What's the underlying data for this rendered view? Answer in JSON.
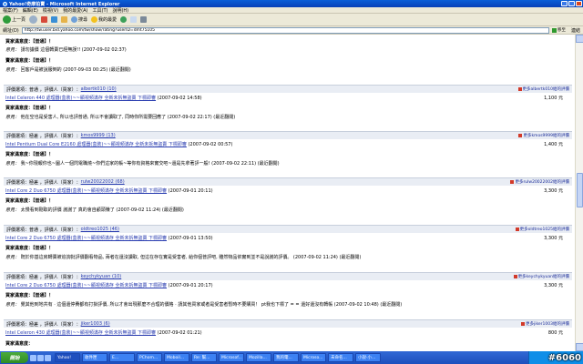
{
  "window": {
    "title": "Yahoo!奇摩拍賣 - Microsoft Internet Explorer",
    "menu": [
      "檔案(F)",
      "編輯(E)",
      "檢視(V)",
      "我的最愛(A)",
      "工具(T)",
      "說明(H)"
    ],
    "toolbar": {
      "back": "上一頁",
      "search": "搜尋",
      "favorites": "我的最愛"
    },
    "address_label": "網址(D)",
    "address_url": "http://tw.user.bid.yahoo.com/tw/show/rating?userID=dmt75105",
    "go_label": "移至",
    "links_label": "連結"
  },
  "top_comments": [
    {
      "label": "買家滿意度：",
      "value": "【普通】！"
    },
    {
      "label": "意見：",
      "text": "請勿議價 這個轉賣已經無誤!! (2007-09-02 02:37)"
    },
    {
      "label": "賣家滿意度：",
      "value": "【普通】！"
    },
    {
      "label": "意見：",
      "text": "回客戶是被說服倒的 (2007-09-03 00:25) (最近翻閱)"
    }
  ],
  "entries": [
    {
      "rating": "普通",
      "role": "評價人（買家）",
      "user": "albertk010 (10)",
      "more": "更多albertk010給的評價",
      "item": "Intel Celeron 440 處理器(盒裝)~~顯視頻滿存 全新未拆無盜賣 下標即審",
      "date": "(2007-09-02 14:58)",
      "price": "1,100 元",
      "buyer_sat": "【普通】！",
      "comment": "他在空也是受害人, 所以也評普通, 所以不會讀取了, 同時你所需要回應了 (2007-09-02 22:17) (最近翻閱)"
    },
    {
      "rating": "極差",
      "role": "評價人（買家）",
      "user": "kmos9999 (13)",
      "more": "更多kmos9999給的評價",
      "item": "Intel Pentium Dual Core E2160 處理器(盒裝)~~顯視頻滿存 全新未拆無盜賣 下標即審",
      "date": "(2007-09-02 00:57)",
      "price": "1,400 元",
      "buyer_sat": "【普通】！",
      "comment": "我~你現報你也~圖人一個閃電職燒~你們這家的帳~等你有資格來實交吧~還是先拿著評一般! (2007-09-02 22:11) (最近翻閱)"
    },
    {
      "rating": "極差",
      "role": "評價人（買家）",
      "user": "rulw20022002 (68)",
      "more": "更多rulw20022002給的評價",
      "item": "Intel Core 2 Duo 6750 處理器(盒裝)~~顯視頻滿存 全新未拆無盜賣 下標即審",
      "date": "(2007-09-01 20:11)",
      "price": "3,300 元",
      "buyer_sat": "【普通】！",
      "comment": "太慢看到剛取的評價 謝謝了 真的會自顧頭賺了 (2007-09-02 11:24) (最近翻閱)"
    },
    {
      "rating": "普通",
      "role": "評價人（買家）",
      "user": "oldtreo1025 (46)",
      "more": "更多oldtreo1025給的評價",
      "item": "Intel Core 2 Duo 6750 處理器(盒裝)~~顯視頻滿存 全新未拆無盜賣 下標即審",
      "date": "(2007-09-01 13:50)",
      "price": "3,300 元",
      "buyer_sat": "【普通】！",
      "comment": "既於你基這房轉賣被追詢批評價翻看物品, 兩者在還沒讀取, 但這在存在實是受害者, 給你個普評吧, 雖然物品依實到並不是說謝的評價。 (2007-09-02 11:24) (最近翻閱)"
    },
    {
      "rating": "極差",
      "role": "評價人（買家）",
      "user": "keychykyuan (10)",
      "more": "更多keychykyuan給的評價",
      "item": "Intel Core 2 Duo 6750 處理器(盒裝)~~顯視頻滿存 全新未拆無盜賣 下標即審",
      "date": "(2007-09-01 20:17)",
      "price": "3,300 元",
      "buyer_sat": "【普通】！",
      "comment": "覺其他到地共有 · 這個還停費都有打掛評價, 所以才會出現那麼不合理的價格 · 請其他買家或者是受害者暫時不要購買！ pt我也下標了 = = 還好還沒有轉帳 (2007-09-02 10:48) (最近翻閱)"
    },
    {
      "rating": "極差",
      "role": "評價人（買家）",
      "user": "jiker1003 (6)",
      "more": "更多jiker1003給的評價",
      "item": "Intel Celeron 430 處理器(盒裝)~~顯視頻滿存 全新未拆無盜賣 下標即審",
      "date": "(2007-09-02 01:21)",
      "price": "800 元",
      "buyer_sat": "",
      "comment": ""
    }
  ],
  "labels": {
    "rating_prefix": "評價選項：",
    "buyer_sat": "買家滿意度：",
    "comment_label": "意見："
  },
  "taskbar": {
    "start": "開始",
    "tasks": [
      "Yahoo!",
      "收件匣",
      "E...",
      "PChom...",
      "Moboil...",
      "Re: 幫...",
      "Microsof...",
      "Mozilla...",
      "我的電...",
      "Microso...",
      "未命名...",
      "小說·小..."
    ]
  },
  "watermark": "#6060"
}
